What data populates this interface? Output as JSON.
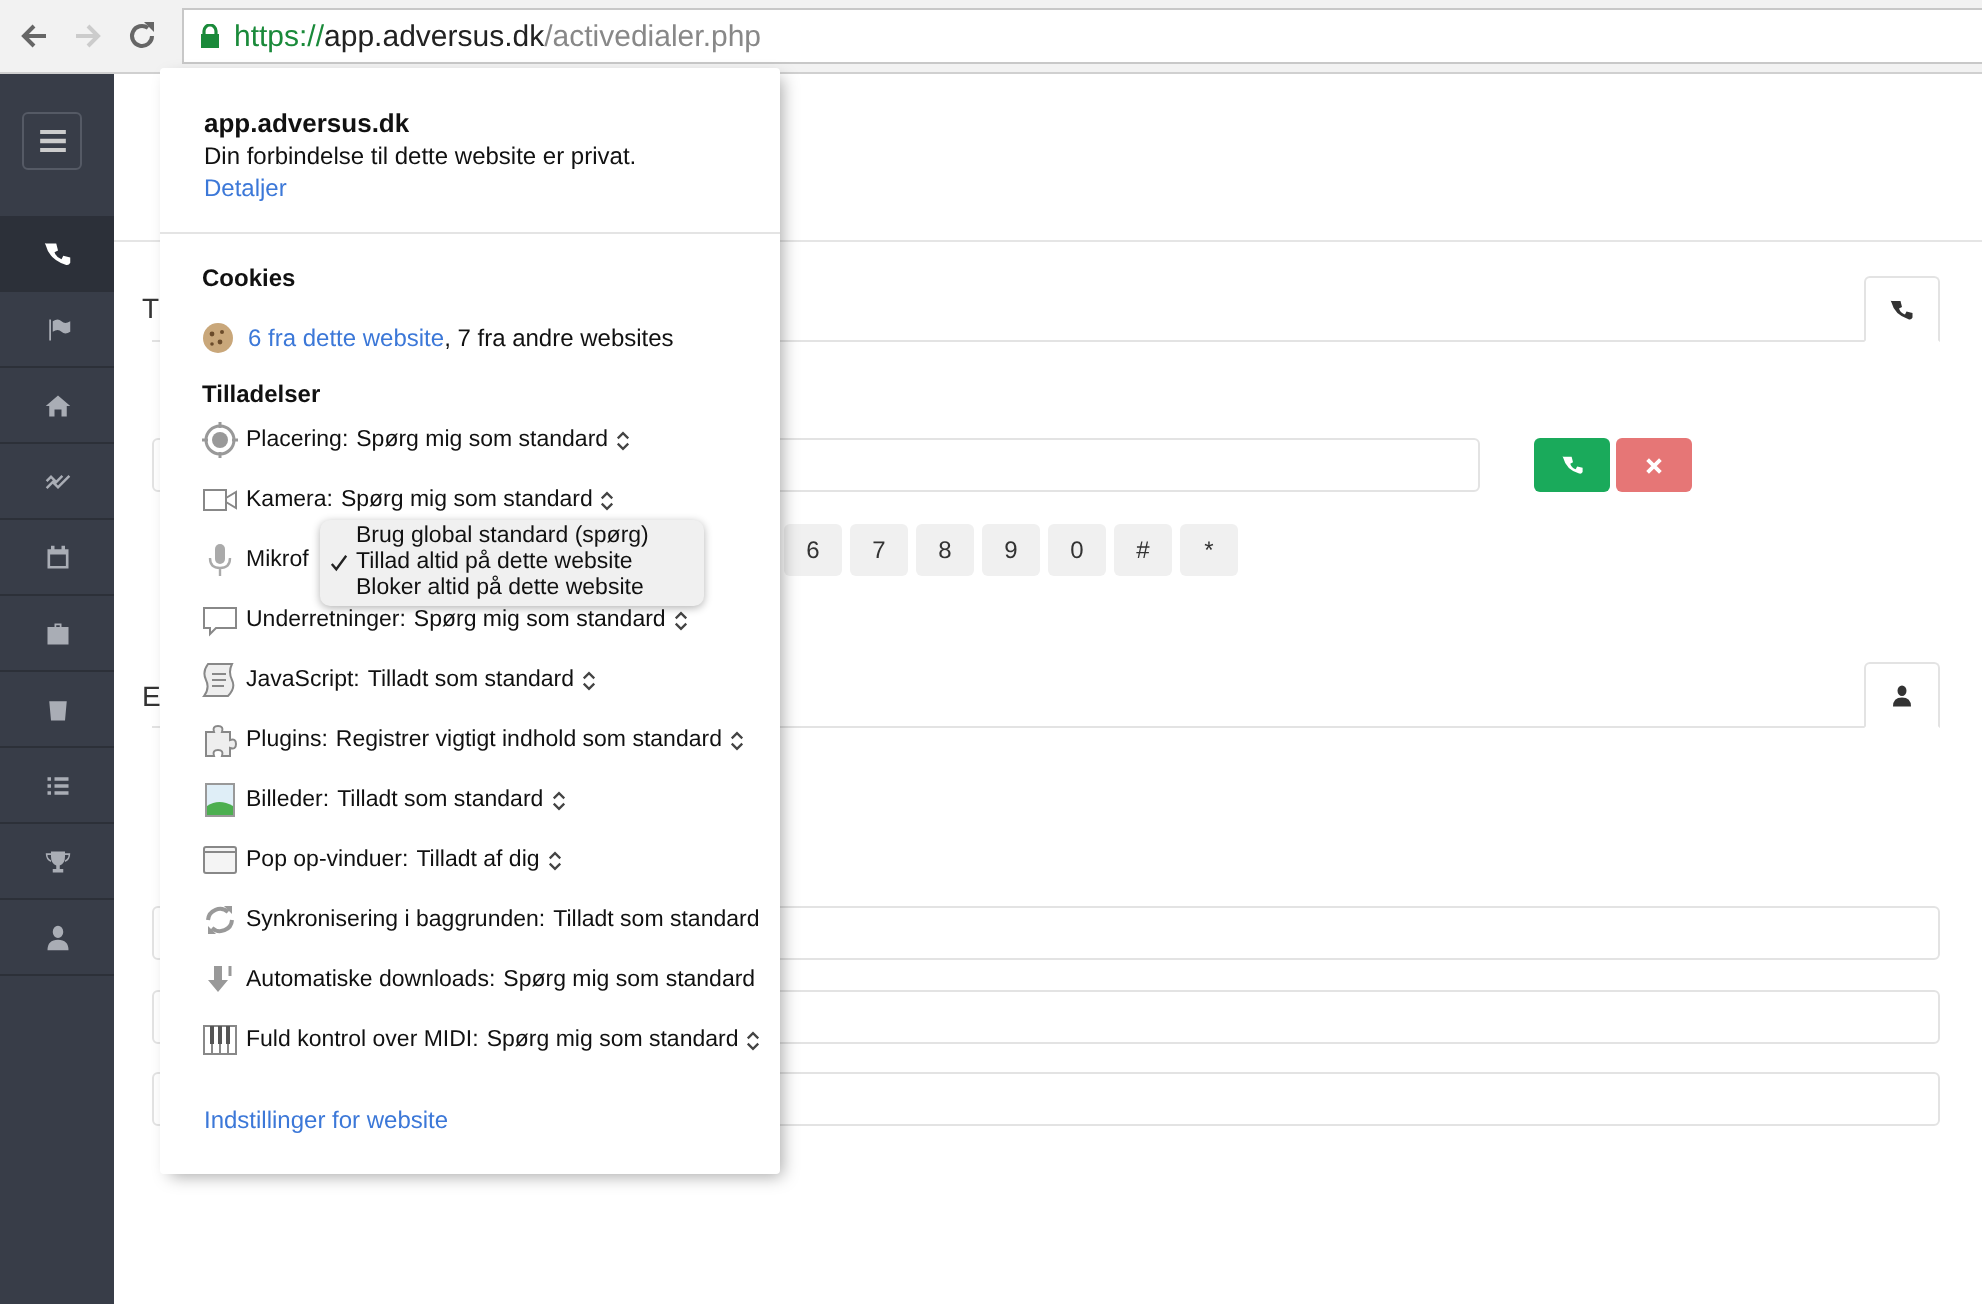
{
  "browser": {
    "back": {
      "disabled": false
    },
    "forward": {
      "disabled": true
    },
    "url": {
      "scheme": "https://",
      "host": "app.adversus.dk",
      "path": "/activedialer.php"
    }
  },
  "sidebar": {
    "items": [
      {
        "kind": "phone",
        "selected": true
      },
      {
        "kind": "flag",
        "selected": false
      },
      {
        "kind": "home",
        "selected": false
      },
      {
        "kind": "chart",
        "selected": false
      },
      {
        "kind": "calendar",
        "selected": false
      },
      {
        "kind": "briefcase",
        "selected": false
      },
      {
        "kind": "bag",
        "selected": false
      },
      {
        "kind": "list",
        "selected": false
      },
      {
        "kind": "trophy",
        "selected": false
      },
      {
        "kind": "user",
        "selected": false
      }
    ]
  },
  "main": {
    "panels": [
      {
        "heading": "T",
        "kind": "dialer"
      },
      {
        "heading": "E",
        "kind": "contact"
      }
    ],
    "keypad": [
      "6",
      "7",
      "8",
      "9",
      "0",
      "#",
      "*"
    ]
  },
  "site_info": {
    "site": "app.adversus.dk",
    "connection": "Din forbindelse til dette website er privat.",
    "details_link": "Detaljer",
    "cookies": {
      "heading": "Cookies",
      "link": "6 fra dette website",
      "text": ", 7 fra andre websites"
    },
    "permissions_heading": "Tilladelser",
    "permissions": [
      {
        "kind": "location",
        "label": "Placering:",
        "value": "Spørg mig som standard",
        "chevron": true
      },
      {
        "kind": "camera",
        "label": "Kamera:",
        "value": "Spørg mig som standard",
        "chevron": true
      },
      {
        "kind": "mic",
        "label": "Mikrof"
      },
      {
        "kind": "chat",
        "label": "Underretninger:",
        "value": "Spørg mig som standard",
        "chevron": true
      },
      {
        "kind": "script",
        "label": "JavaScript:",
        "value": "Tilladt som standard",
        "chevron": true
      },
      {
        "kind": "puzzle",
        "label": "Plugins:",
        "value": "Registrer vigtigt indhold som standard",
        "chevron": true
      },
      {
        "kind": "image",
        "label": "Billeder:",
        "value": "Tilladt som standard",
        "chevron": true
      },
      {
        "kind": "window",
        "label": "Pop op-vinduer:",
        "value": "Tilladt af dig",
        "chevron": true
      },
      {
        "kind": "sync",
        "label": "Synkronisering i baggrunden:",
        "value": "Tilladt som standard",
        "chevron": false
      },
      {
        "kind": "download",
        "label": "Automatiske downloads:",
        "value": "Spørg mig som standard",
        "chevron": false
      },
      {
        "kind": "midi",
        "label": "Fuld kontrol over MIDI:",
        "value": "Spørg mig som standard",
        "chevron": true
      }
    ],
    "settings_link": "Indstillinger for website"
  },
  "dropdown": {
    "options": [
      {
        "label": "Brug global standard (spørg)",
        "selected": false
      },
      {
        "label": "Tillad altid på dette website",
        "selected": true
      },
      {
        "label": "Bloker altid på dette website",
        "selected": false
      }
    ]
  }
}
